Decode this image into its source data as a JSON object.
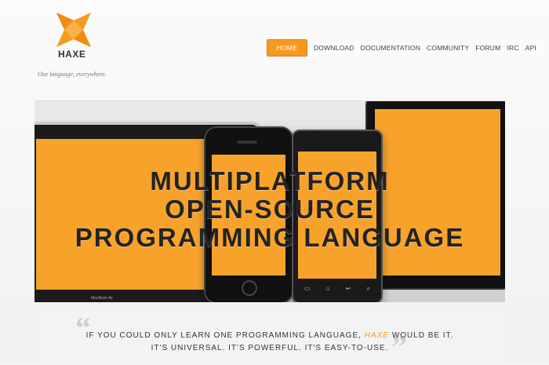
{
  "brand": {
    "name": "HAXE",
    "tagline": "One language, everywhere.",
    "accent_color": "#f59b22"
  },
  "nav": {
    "items": [
      {
        "label": "HOME",
        "active": true
      },
      {
        "label": "DOWNLOAD",
        "active": false
      },
      {
        "label": "DOCUMENTATION",
        "active": false
      },
      {
        "label": "COMMUNITY",
        "active": false
      },
      {
        "label": "FORUM",
        "active": false
      },
      {
        "label": "IRC",
        "active": false
      },
      {
        "label": "API",
        "active": false
      }
    ]
  },
  "hero": {
    "line1": "MULTIPLATFORM",
    "line2": "OPEN-SOURCE",
    "line3": "PROGRAMMING LANGUAGE",
    "laptop_brand": "MacBook Air"
  },
  "quote": {
    "open_mark": "“",
    "close_mark": "”",
    "line1_before": "IF YOU COULD ONLY LEARN ONE PROGRAMMING LANGUAGE,",
    "line1_em": "HAXE",
    "line1_after": "WOULD BE IT.",
    "line2": "IT'S UNIVERSAL. IT'S POWERFUL. IT'S EASY-TO-USE."
  }
}
